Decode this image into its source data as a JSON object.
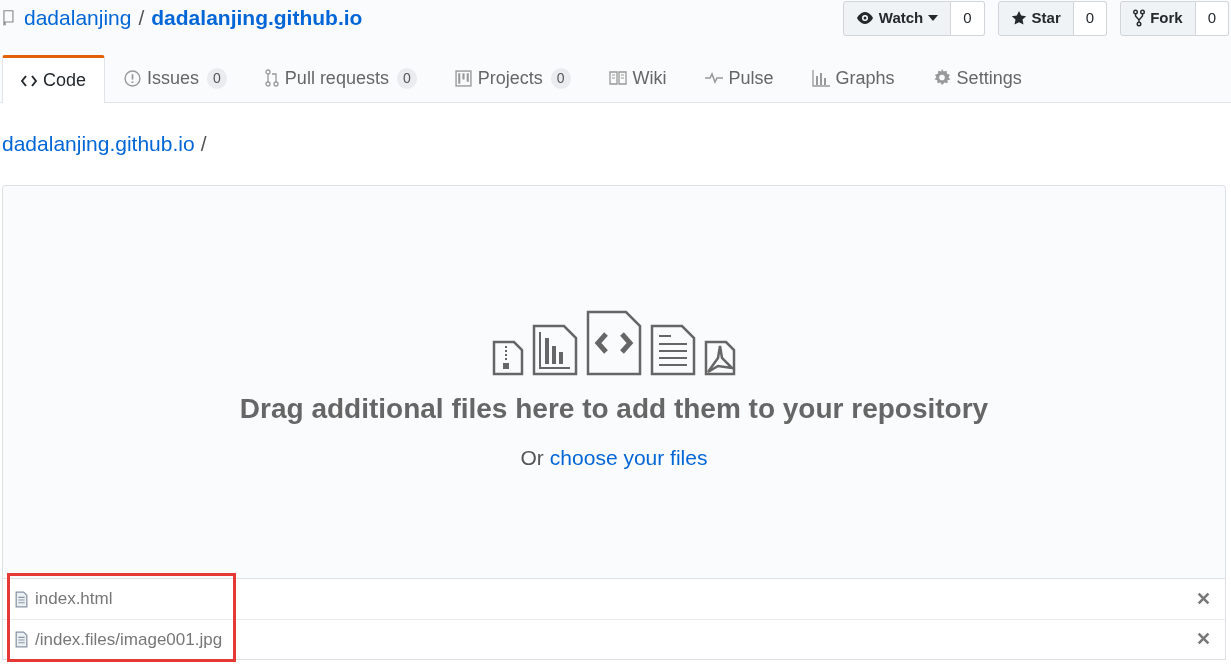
{
  "repo": {
    "owner": "dadalanjing",
    "separator": "/",
    "name": "dadalanjing.github.io"
  },
  "actions": [
    {
      "label": "Watch",
      "count": "0",
      "dropdown": true
    },
    {
      "label": "Star",
      "count": "0",
      "dropdown": false
    },
    {
      "label": "Fork",
      "count": "0",
      "dropdown": false
    }
  ],
  "tabs": [
    {
      "label": "Code",
      "selected": true
    },
    {
      "label": "Issues",
      "count": "0",
      "selected": false
    },
    {
      "label": "Pull requests",
      "count": "0",
      "selected": false
    },
    {
      "label": "Projects",
      "count": "0",
      "selected": false
    },
    {
      "label": "Wiki",
      "selected": false
    },
    {
      "label": "Pulse",
      "selected": false
    },
    {
      "label": "Graphs",
      "selected": false
    },
    {
      "label": "Settings",
      "selected": false
    }
  ],
  "breadcrumb": {
    "repo_link": "dadalanjing.github.io",
    "separator": "/"
  },
  "dropzone": {
    "heading": "Drag additional files here to add them to your repository",
    "prompt": "Or",
    "link": "choose your files"
  },
  "files": [
    {
      "name": "index.html",
      "remove": "✕"
    },
    {
      "name": "/index.files/image001.jpg",
      "remove": "✕"
    }
  ]
}
